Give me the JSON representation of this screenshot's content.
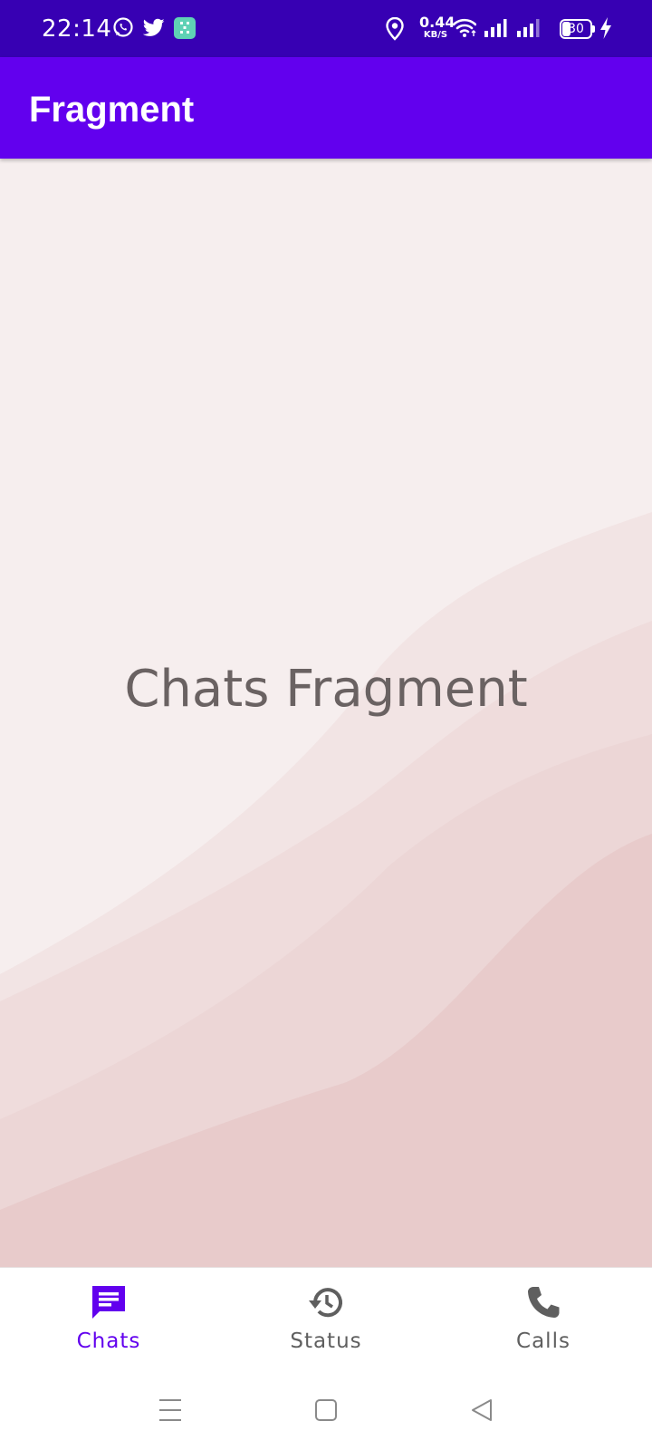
{
  "status_bar": {
    "time": "22:14",
    "net_speed_value": "0.44",
    "net_speed_unit": "KB/S",
    "battery_level": "30",
    "notification_icons": [
      "whatsapp-icon",
      "twitter-icon",
      "app-notification-icon"
    ],
    "system_icons": [
      "location-icon",
      "wifi-icon",
      "signal-icon",
      "signal-icon",
      "battery-icon",
      "charging-icon"
    ]
  },
  "app_bar": {
    "title": "Fragment"
  },
  "content": {
    "text": "Chats Fragment"
  },
  "bottom_nav": {
    "items": [
      {
        "label": "Chats",
        "icon": "chat-icon",
        "active": true
      },
      {
        "label": "Status",
        "icon": "history-icon",
        "active": false
      },
      {
        "label": "Calls",
        "icon": "phone-icon",
        "active": false
      }
    ]
  },
  "system_nav": {
    "buttons": [
      "menu-icon",
      "home-icon",
      "back-icon"
    ]
  },
  "colors": {
    "status_bar": "#3700b3",
    "app_bar": "#6200ee",
    "accent": "#6200ee",
    "inactive_icon": "#5f5f5f",
    "content_background": "#f5ecec"
  }
}
